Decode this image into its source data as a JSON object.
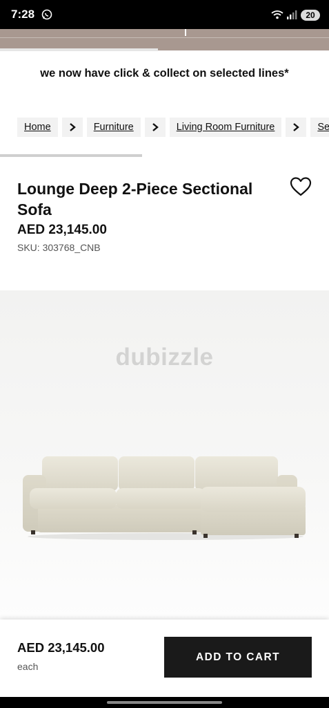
{
  "status_bar": {
    "time": "7:28",
    "battery": "20",
    "icons": [
      "whatsapp-icon",
      "wifi-icon",
      "signal-icon",
      "battery-icon"
    ]
  },
  "promo": {
    "text": "we now have click & collect on selected lines*"
  },
  "breadcrumb": {
    "items": [
      "Home",
      "Furniture",
      "Living Room Furniture",
      "Se"
    ],
    "separator_icon": "chevron-right-icon"
  },
  "product": {
    "title": "Lounge Deep 2-Piece Sectional Sofa",
    "price": "AED 23,145.00",
    "sku": "SKU: 303768_CNB",
    "wishlist_icon": "heart-icon"
  },
  "image": {
    "watermark": "dubizzle"
  },
  "cart_bar": {
    "price": "AED 23,145.00",
    "unit": "each",
    "button_label": "ADD TO CART"
  },
  "colors": {
    "promo_strip": "#a89890",
    "button": "#1a1a1a",
    "sofa_fabric": "#e6e3d6"
  }
}
